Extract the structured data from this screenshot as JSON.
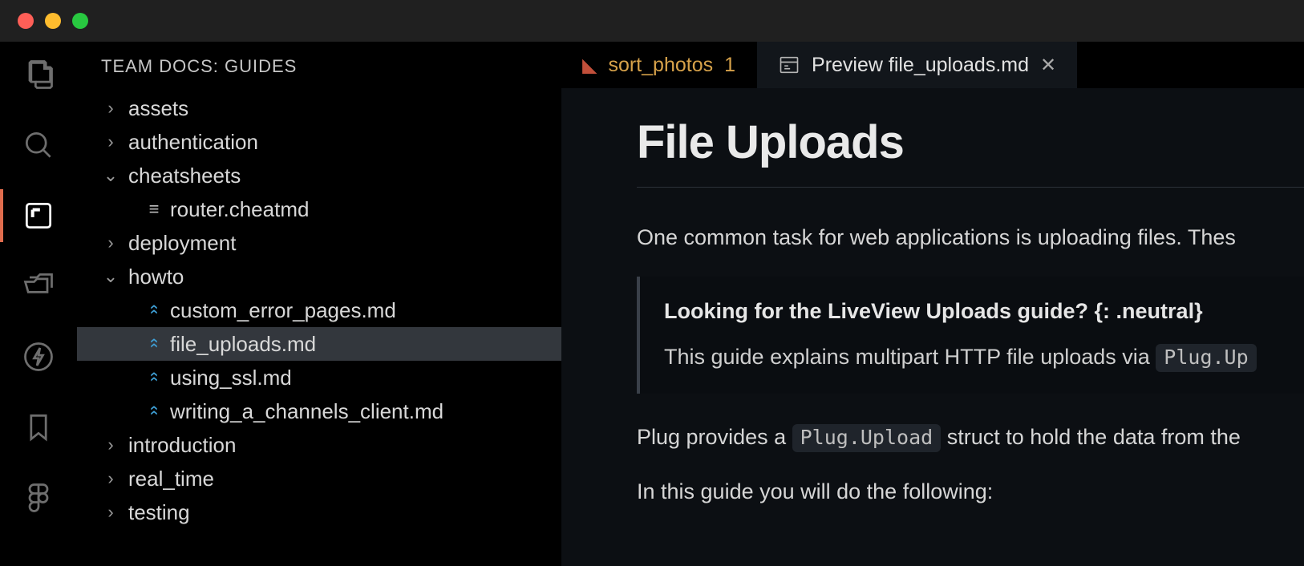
{
  "window": {
    "traffic": [
      "close",
      "minimize",
      "zoom"
    ]
  },
  "activitybar": {
    "items": [
      {
        "name": "explorer",
        "active": false
      },
      {
        "name": "search",
        "active": false
      },
      {
        "name": "docs",
        "active": true
      },
      {
        "name": "files",
        "active": false
      },
      {
        "name": "thunder",
        "active": false
      },
      {
        "name": "bookmarks",
        "active": false
      },
      {
        "name": "figma",
        "active": false
      }
    ]
  },
  "sidebar": {
    "header": "TEAM DOCS: GUIDES",
    "tree": [
      {
        "type": "folder",
        "expanded": false,
        "depth": 0,
        "label": "assets"
      },
      {
        "type": "folder",
        "expanded": false,
        "depth": 0,
        "label": "authentication"
      },
      {
        "type": "folder",
        "expanded": true,
        "depth": 0,
        "label": "cheatsheets"
      },
      {
        "type": "file",
        "depth": 1,
        "icon": "cheatmd",
        "label": "router.cheatmd"
      },
      {
        "type": "folder",
        "expanded": false,
        "depth": 0,
        "label": "deployment"
      },
      {
        "type": "folder",
        "expanded": true,
        "depth": 0,
        "label": "howto"
      },
      {
        "type": "file",
        "depth": 1,
        "icon": "md",
        "label": "custom_error_pages.md"
      },
      {
        "type": "file",
        "depth": 1,
        "icon": "md",
        "label": "file_uploads.md",
        "selected": true
      },
      {
        "type": "file",
        "depth": 1,
        "icon": "md",
        "label": "using_ssl.md"
      },
      {
        "type": "file",
        "depth": 1,
        "icon": "md",
        "label": "writing_a_channels_client.md"
      },
      {
        "type": "folder",
        "expanded": false,
        "depth": 0,
        "label": "introduction"
      },
      {
        "type": "folder",
        "expanded": false,
        "depth": 0,
        "label": "real_time"
      },
      {
        "type": "folder",
        "expanded": false,
        "depth": 0,
        "label": "testing"
      }
    ]
  },
  "tabs": {
    "items": [
      {
        "icon": "ruby",
        "label": "sort_photos",
        "badge": "1",
        "active": false
      },
      {
        "icon": "preview",
        "label": "Preview file_uploads.md",
        "active": true,
        "closable": true
      }
    ]
  },
  "preview": {
    "title": "File Uploads",
    "intro": "One common task for web applications is uploading files. Thes",
    "callout": {
      "title": "Looking for the LiveView Uploads guide? {: .neutral}",
      "body_pre": "This guide explains multipart HTTP file uploads via ",
      "body_code": "Plug.Up"
    },
    "para2_pre": "Plug provides a ",
    "para2_code": "Plug.Upload",
    "para2_post": " struct to hold the data from the",
    "para3": "In this guide you will do the following:"
  }
}
